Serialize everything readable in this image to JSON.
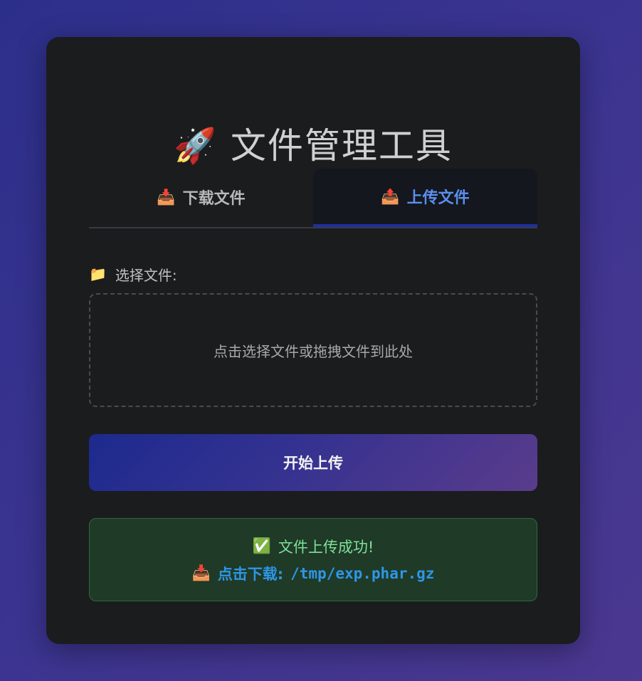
{
  "title": {
    "icon": "rocket-icon",
    "emoji": "🚀",
    "text": "文件管理工具"
  },
  "tabs": [
    {
      "icon": "inbox-tray-icon",
      "emoji": "📥",
      "label": "下载文件",
      "active": false
    },
    {
      "icon": "outbox-tray-icon",
      "emoji": "📤",
      "label": "上传文件",
      "active": true
    }
  ],
  "upload_form": {
    "file_label_icon": "folder-icon",
    "file_label_emoji": "📁",
    "file_label": "选择文件:",
    "dropzone_text": "点击选择文件或拖拽文件到此处",
    "submit_label": "开始上传"
  },
  "result": {
    "success_icon": "check-mark-icon",
    "success_emoji": "✅",
    "success_text": "文件上传成功!",
    "download_icon": "inbox-tray-icon",
    "download_emoji": "📥",
    "download_label": "点击下载:",
    "download_path": "/tmp/exp.phar.gz"
  },
  "colors": {
    "background_start": "#2c2f8a",
    "background_end": "#4b3890",
    "card": "#1b1c1e",
    "active_tab_text": "#5b8ff0",
    "success_bg": "#1f3a27",
    "success_text": "#7fe09a",
    "link": "#2e96e6"
  }
}
